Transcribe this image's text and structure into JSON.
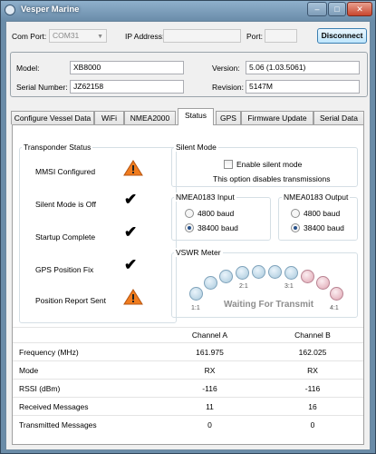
{
  "window": {
    "title": "Vesper Marine",
    "minimize": "–",
    "maximize": "□",
    "close": "✕"
  },
  "connection": {
    "com_port_label": "Com Port:",
    "com_port_value": "COM31",
    "ip_label": "IP Address:",
    "ip_value": "",
    "port_label": "Port:",
    "port_value": "",
    "disconnect": "Disconnect"
  },
  "device": {
    "model_label": "Model:",
    "model": "XB8000",
    "serial_label": "Serial Number:",
    "serial": "JZ62158",
    "version_label": "Version:",
    "version": "5.06 (1.03.5061)",
    "revision_label": "Revision:",
    "revision": "5147M"
  },
  "tabs": [
    "Configure Vessel Data",
    "WiFi",
    "NMEA2000",
    "Status",
    "GPS",
    "Firmware Update",
    "Serial Data"
  ],
  "active_tab": "Status",
  "transponder": {
    "title": "Transponder Status",
    "items": [
      {
        "label": "MMSI Configured",
        "state": "warning"
      },
      {
        "label": "Silent Mode is Off",
        "state": "ok"
      },
      {
        "label": "Startup Complete",
        "state": "ok"
      },
      {
        "label": "GPS Position Fix",
        "state": "ok"
      },
      {
        "label": "Position Report Sent",
        "state": "warning"
      }
    ]
  },
  "silent_mode": {
    "title": "Silent Mode",
    "checkbox_label": "Enable silent mode",
    "checked": false,
    "note": "This option disables transmissions"
  },
  "nmea_input": {
    "title": "NMEA0183 Input",
    "options": [
      "4800 baud",
      "38400 baud"
    ],
    "selected": "38400 baud"
  },
  "nmea_output": {
    "title": "NMEA0183 Output",
    "options": [
      "4800 baud",
      "38400 baud"
    ],
    "selected": "38400 baud"
  },
  "vswr": {
    "title": "VSWR Meter",
    "tick_labels": [
      "1:1",
      "2:1",
      "3:1",
      "4:1"
    ],
    "status": "Waiting For Transmit",
    "colors": {
      "normal": "#a9c9dc",
      "high": "#dfa4b1"
    }
  },
  "channels": {
    "headers": [
      "",
      "Channel A",
      "Channel B"
    ],
    "rows": [
      [
        "Frequency (MHz)",
        "161.975",
        "162.025"
      ],
      [
        "Mode",
        "RX",
        "RX"
      ],
      [
        "RSSI (dBm)",
        "-116",
        "-116"
      ],
      [
        "Received Messages",
        "11",
        "16"
      ],
      [
        "Transmitted Messages",
        "0",
        "0"
      ]
    ]
  },
  "colors": {
    "warning": "#f07c1e",
    "accent": "#3c7fb1"
  }
}
